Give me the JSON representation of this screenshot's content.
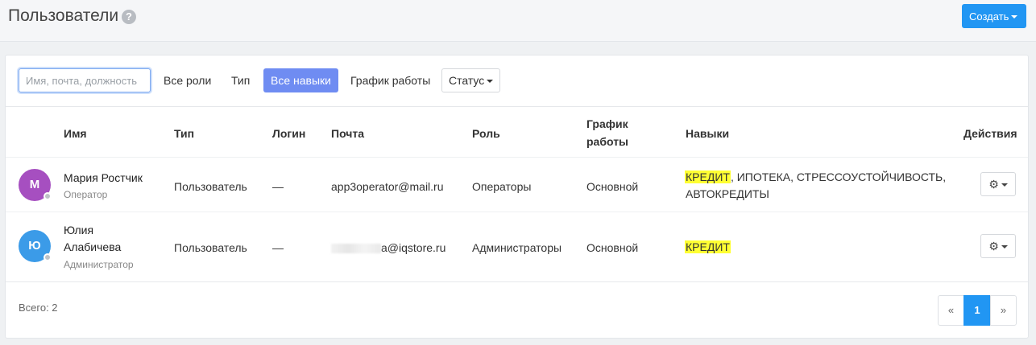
{
  "header": {
    "title": "Пользователи",
    "help_icon": "question-circle-icon",
    "create_label": "Создать"
  },
  "toolbar": {
    "search_placeholder": "Имя, почта, должность",
    "filters": {
      "roles": "Все роли",
      "type": "Тип",
      "skills": "Все навыки",
      "schedule": "График работы",
      "status": "Статус"
    }
  },
  "table": {
    "headers": {
      "name": "Имя",
      "type": "Тип",
      "login": "Логин",
      "email": "Почта",
      "role": "Роль",
      "schedule_line1": "График",
      "schedule_line2": "работы",
      "skills": "Навыки",
      "actions": "Действия"
    },
    "rows": [
      {
        "avatar_letter": "М",
        "avatar_color": "#a64fc0",
        "name": "Мария Ростчик",
        "position": "Оператор",
        "type": "Пользователь",
        "login": "—",
        "email": "app3operator@mail.ru",
        "role": "Операторы",
        "schedule": "Основной",
        "skill_highlight": "КРЕДИТ",
        "skills_rest_line1": ", ИПОТЕКА, СТРЕССОУСТОЙЧИВОСТЬ,",
        "skills_rest_line2": "АВТОКРЕДИТЫ"
      },
      {
        "avatar_letter": "Ю",
        "avatar_color": "#3b9be8",
        "name_line1": "Юлия",
        "name_line2": "Алабичева",
        "position": "Администратор",
        "type": "Пользователь",
        "login": "—",
        "email_visible": "a@iqstore.ru",
        "role": "Администраторы",
        "schedule": "Основной",
        "skill_highlight": "КРЕДИТ"
      }
    ]
  },
  "footer": {
    "total": "Всего: 2",
    "pager_prev": "«",
    "pager_current": "1",
    "pager_next": "»"
  },
  "colors": {
    "accent": "#2196f3",
    "active_filter": "#6f8cf2",
    "highlight": "#ffff33"
  }
}
